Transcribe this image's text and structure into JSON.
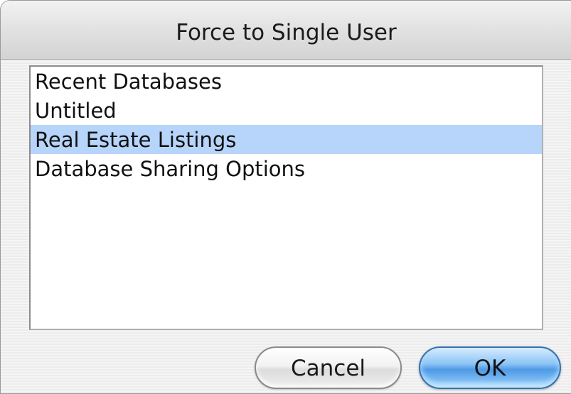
{
  "dialog": {
    "title": "Force to Single User"
  },
  "list": {
    "items": [
      {
        "label": "Recent Databases",
        "selected": false
      },
      {
        "label": "Untitled",
        "selected": false
      },
      {
        "label": "Real Estate Listings",
        "selected": true
      },
      {
        "label": "Database Sharing Options",
        "selected": false
      }
    ]
  },
  "buttons": {
    "cancel_label": "Cancel",
    "ok_label": "OK"
  },
  "colors": {
    "selection": "#b7d4fa",
    "default_button": "#5fa6ea"
  }
}
